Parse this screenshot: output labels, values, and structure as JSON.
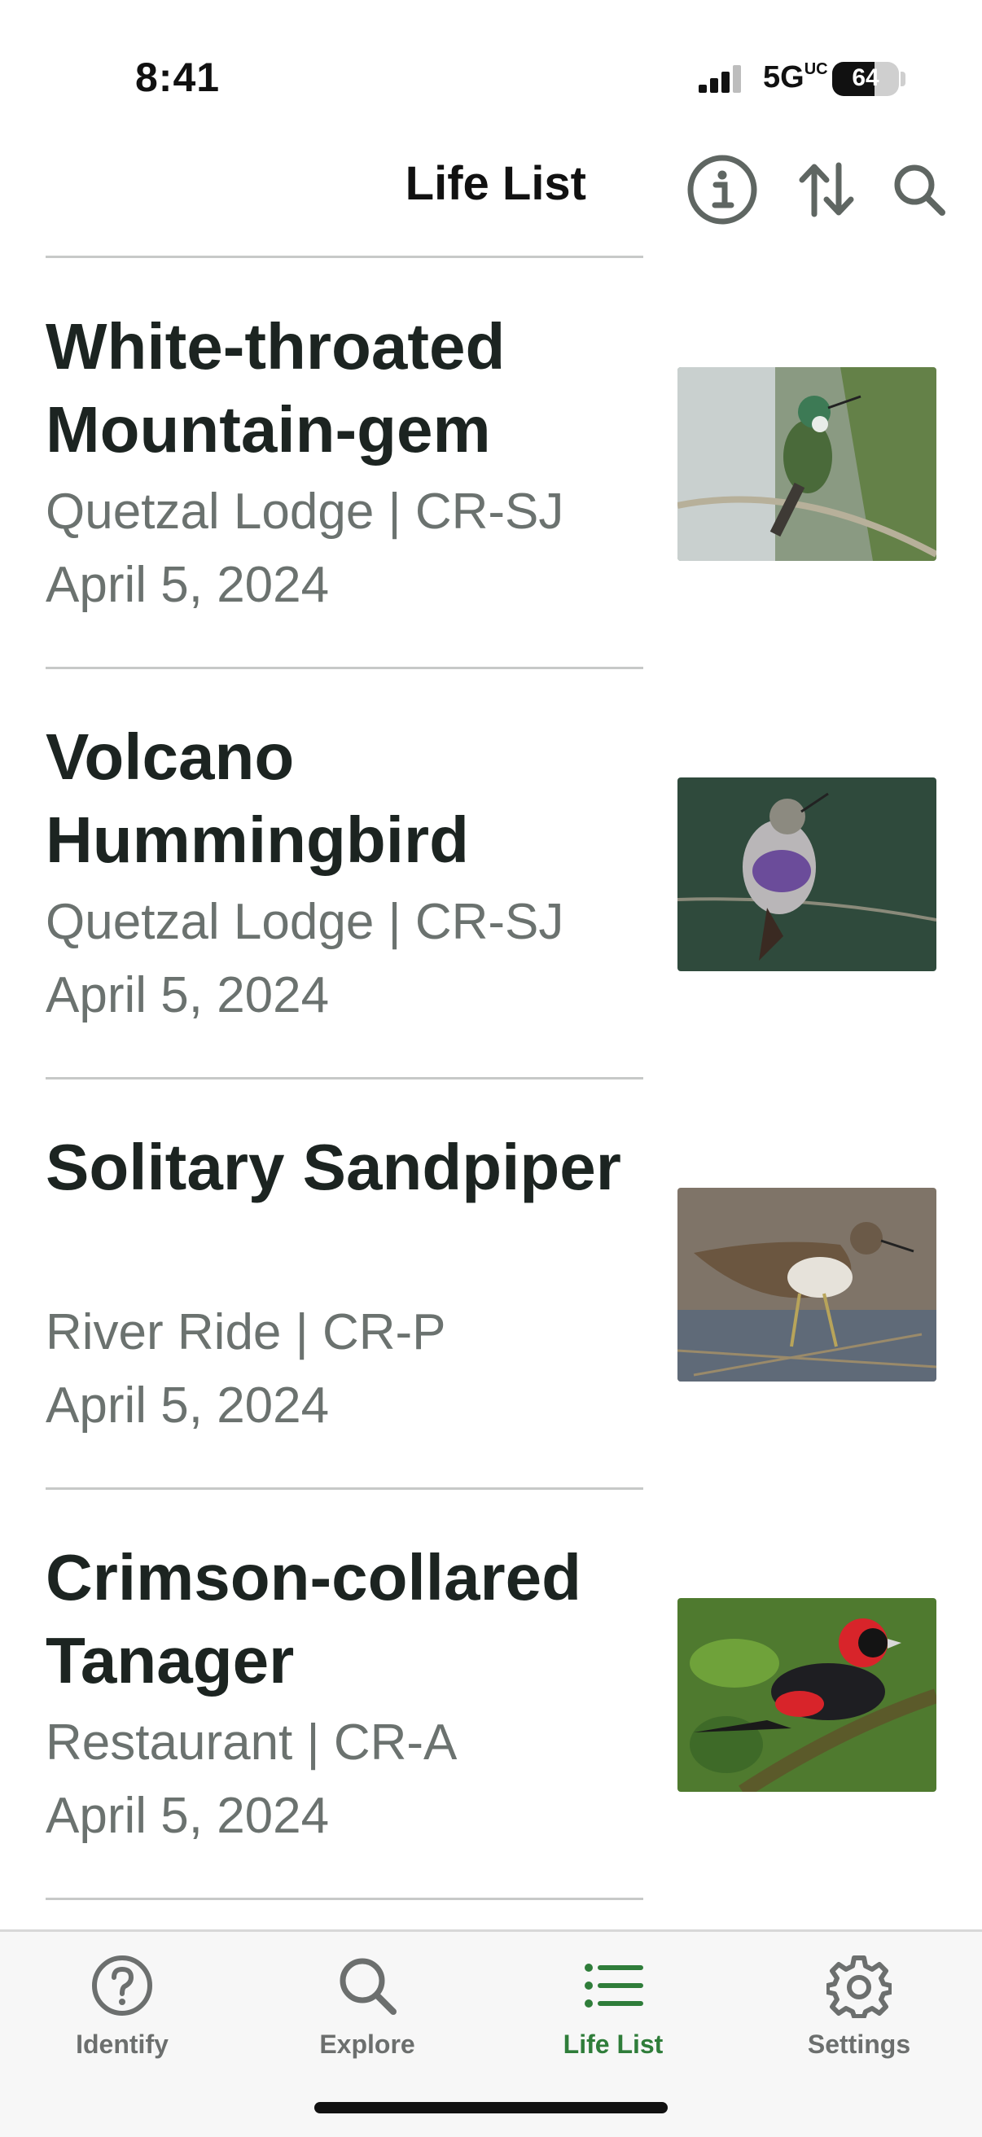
{
  "status": {
    "time": "8:41",
    "network": "5G",
    "network_sup": "UC",
    "battery": "64",
    "battery_level": 0.64
  },
  "header": {
    "title": "Life List",
    "info_icon": "info-icon",
    "sort_icon": "sort-icon",
    "search_icon": "search-icon"
  },
  "items": [
    {
      "name": "White-throated Mountain-gem",
      "location": "Quetzal Lodge | CR-SJ",
      "date": "April 5, 2024"
    },
    {
      "name": "Volcano Hummingbird",
      "location": "Quetzal Lodge | CR-SJ",
      "date": "April 5, 2024"
    },
    {
      "name": "Solitary Sandpiper",
      "location": "River Ride | CR-P",
      "date": "April 5, 2024"
    },
    {
      "name": "Crimson-collared Tanager",
      "location": "Restaurant | CR-A",
      "date": "April 5, 2024"
    }
  ],
  "tabs": [
    {
      "label": "Identify",
      "icon": "help-circle-icon",
      "active": false
    },
    {
      "label": "Explore",
      "icon": "search-icon",
      "active": false
    },
    {
      "label": "Life List",
      "icon": "list-icon",
      "active": true
    },
    {
      "label": "Settings",
      "icon": "gear-icon",
      "active": false
    }
  ],
  "colors": {
    "accent": "#2f7d3a",
    "icon_gray": "#5f6662",
    "text_dark": "#1c2421",
    "text_muted": "#6b726f"
  }
}
